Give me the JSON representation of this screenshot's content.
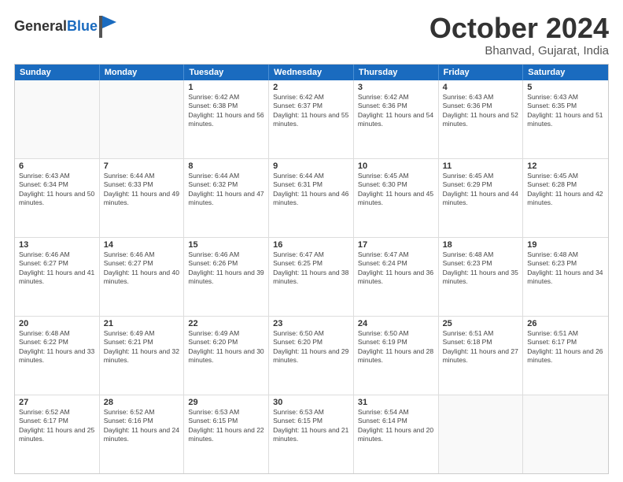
{
  "logo": {
    "general": "General",
    "blue": "Blue"
  },
  "header": {
    "month": "October 2024",
    "location": "Bhanvad, Gujarat, India"
  },
  "weekdays": [
    "Sunday",
    "Monday",
    "Tuesday",
    "Wednesday",
    "Thursday",
    "Friday",
    "Saturday"
  ],
  "rows": [
    [
      {
        "day": "",
        "sunrise": "",
        "sunset": "",
        "daylight": "",
        "empty": true
      },
      {
        "day": "",
        "sunrise": "",
        "sunset": "",
        "daylight": "",
        "empty": true
      },
      {
        "day": "1",
        "sunrise": "Sunrise: 6:42 AM",
        "sunset": "Sunset: 6:38 PM",
        "daylight": "Daylight: 11 hours and 56 minutes."
      },
      {
        "day": "2",
        "sunrise": "Sunrise: 6:42 AM",
        "sunset": "Sunset: 6:37 PM",
        "daylight": "Daylight: 11 hours and 55 minutes."
      },
      {
        "day": "3",
        "sunrise": "Sunrise: 6:42 AM",
        "sunset": "Sunset: 6:36 PM",
        "daylight": "Daylight: 11 hours and 54 minutes."
      },
      {
        "day": "4",
        "sunrise": "Sunrise: 6:43 AM",
        "sunset": "Sunset: 6:36 PM",
        "daylight": "Daylight: 11 hours and 52 minutes."
      },
      {
        "day": "5",
        "sunrise": "Sunrise: 6:43 AM",
        "sunset": "Sunset: 6:35 PM",
        "daylight": "Daylight: 11 hours and 51 minutes."
      }
    ],
    [
      {
        "day": "6",
        "sunrise": "Sunrise: 6:43 AM",
        "sunset": "Sunset: 6:34 PM",
        "daylight": "Daylight: 11 hours and 50 minutes."
      },
      {
        "day": "7",
        "sunrise": "Sunrise: 6:44 AM",
        "sunset": "Sunset: 6:33 PM",
        "daylight": "Daylight: 11 hours and 49 minutes."
      },
      {
        "day": "8",
        "sunrise": "Sunrise: 6:44 AM",
        "sunset": "Sunset: 6:32 PM",
        "daylight": "Daylight: 11 hours and 47 minutes."
      },
      {
        "day": "9",
        "sunrise": "Sunrise: 6:44 AM",
        "sunset": "Sunset: 6:31 PM",
        "daylight": "Daylight: 11 hours and 46 minutes."
      },
      {
        "day": "10",
        "sunrise": "Sunrise: 6:45 AM",
        "sunset": "Sunset: 6:30 PM",
        "daylight": "Daylight: 11 hours and 45 minutes."
      },
      {
        "day": "11",
        "sunrise": "Sunrise: 6:45 AM",
        "sunset": "Sunset: 6:29 PM",
        "daylight": "Daylight: 11 hours and 44 minutes."
      },
      {
        "day": "12",
        "sunrise": "Sunrise: 6:45 AM",
        "sunset": "Sunset: 6:28 PM",
        "daylight": "Daylight: 11 hours and 42 minutes."
      }
    ],
    [
      {
        "day": "13",
        "sunrise": "Sunrise: 6:46 AM",
        "sunset": "Sunset: 6:27 PM",
        "daylight": "Daylight: 11 hours and 41 minutes."
      },
      {
        "day": "14",
        "sunrise": "Sunrise: 6:46 AM",
        "sunset": "Sunset: 6:27 PM",
        "daylight": "Daylight: 11 hours and 40 minutes."
      },
      {
        "day": "15",
        "sunrise": "Sunrise: 6:46 AM",
        "sunset": "Sunset: 6:26 PM",
        "daylight": "Daylight: 11 hours and 39 minutes."
      },
      {
        "day": "16",
        "sunrise": "Sunrise: 6:47 AM",
        "sunset": "Sunset: 6:25 PM",
        "daylight": "Daylight: 11 hours and 38 minutes."
      },
      {
        "day": "17",
        "sunrise": "Sunrise: 6:47 AM",
        "sunset": "Sunset: 6:24 PM",
        "daylight": "Daylight: 11 hours and 36 minutes."
      },
      {
        "day": "18",
        "sunrise": "Sunrise: 6:48 AM",
        "sunset": "Sunset: 6:23 PM",
        "daylight": "Daylight: 11 hours and 35 minutes."
      },
      {
        "day": "19",
        "sunrise": "Sunrise: 6:48 AM",
        "sunset": "Sunset: 6:23 PM",
        "daylight": "Daylight: 11 hours and 34 minutes."
      }
    ],
    [
      {
        "day": "20",
        "sunrise": "Sunrise: 6:48 AM",
        "sunset": "Sunset: 6:22 PM",
        "daylight": "Daylight: 11 hours and 33 minutes."
      },
      {
        "day": "21",
        "sunrise": "Sunrise: 6:49 AM",
        "sunset": "Sunset: 6:21 PM",
        "daylight": "Daylight: 11 hours and 32 minutes."
      },
      {
        "day": "22",
        "sunrise": "Sunrise: 6:49 AM",
        "sunset": "Sunset: 6:20 PM",
        "daylight": "Daylight: 11 hours and 30 minutes."
      },
      {
        "day": "23",
        "sunrise": "Sunrise: 6:50 AM",
        "sunset": "Sunset: 6:20 PM",
        "daylight": "Daylight: 11 hours and 29 minutes."
      },
      {
        "day": "24",
        "sunrise": "Sunrise: 6:50 AM",
        "sunset": "Sunset: 6:19 PM",
        "daylight": "Daylight: 11 hours and 28 minutes."
      },
      {
        "day": "25",
        "sunrise": "Sunrise: 6:51 AM",
        "sunset": "Sunset: 6:18 PM",
        "daylight": "Daylight: 11 hours and 27 minutes."
      },
      {
        "day": "26",
        "sunrise": "Sunrise: 6:51 AM",
        "sunset": "Sunset: 6:17 PM",
        "daylight": "Daylight: 11 hours and 26 minutes."
      }
    ],
    [
      {
        "day": "27",
        "sunrise": "Sunrise: 6:52 AM",
        "sunset": "Sunset: 6:17 PM",
        "daylight": "Daylight: 11 hours and 25 minutes."
      },
      {
        "day": "28",
        "sunrise": "Sunrise: 6:52 AM",
        "sunset": "Sunset: 6:16 PM",
        "daylight": "Daylight: 11 hours and 24 minutes."
      },
      {
        "day": "29",
        "sunrise": "Sunrise: 6:53 AM",
        "sunset": "Sunset: 6:15 PM",
        "daylight": "Daylight: 11 hours and 22 minutes."
      },
      {
        "day": "30",
        "sunrise": "Sunrise: 6:53 AM",
        "sunset": "Sunset: 6:15 PM",
        "daylight": "Daylight: 11 hours and 21 minutes."
      },
      {
        "day": "31",
        "sunrise": "Sunrise: 6:54 AM",
        "sunset": "Sunset: 6:14 PM",
        "daylight": "Daylight: 11 hours and 20 minutes."
      },
      {
        "day": "",
        "sunrise": "",
        "sunset": "",
        "daylight": "",
        "empty": true
      },
      {
        "day": "",
        "sunrise": "",
        "sunset": "",
        "daylight": "",
        "empty": true
      }
    ]
  ]
}
